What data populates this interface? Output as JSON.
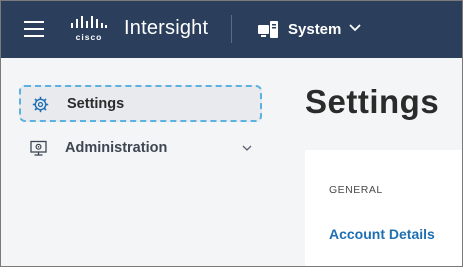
{
  "header": {
    "logo_text": "cisco",
    "app_name": "Intersight",
    "scope_label": "System"
  },
  "sidebar": {
    "items": [
      {
        "label": "Settings",
        "active": true,
        "icon": "gear-icon"
      },
      {
        "label": "Administration",
        "active": false,
        "icon": "monitor-gear-icon"
      }
    ]
  },
  "main": {
    "title": "Settings",
    "section": "GENERAL",
    "links": [
      "Account Details"
    ]
  },
  "colors": {
    "header_bg": "#2b3e5c",
    "active_outline": "#5bb1e0",
    "link": "#1f6fb2"
  }
}
